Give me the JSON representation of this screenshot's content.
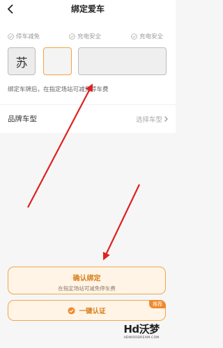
{
  "header": {
    "title": "绑定爱车",
    "back_icon": "chevron-left-icon"
  },
  "benefits": [
    {
      "label": "停车减免",
      "icon": "check-circle-icon"
    },
    {
      "label": "充电安全",
      "icon": "check-circle-icon"
    },
    {
      "label": "充电安全",
      "icon": "check-circle-icon"
    }
  ],
  "plate": {
    "province": "苏",
    "letter": "",
    "number": ""
  },
  "hint": "绑定车牌后，在指定场站可减免停车费",
  "brand_row": {
    "label": "品牌车型",
    "value": "选择车型",
    "icon": "chevron-right-icon"
  },
  "confirm_button": {
    "label": "确认绑定",
    "sublabel": "在指定场站可减免停车费"
  },
  "auth_button": {
    "label": "一键认证",
    "badge": "推荐",
    "icon": "check-circle-icon"
  },
  "watermark": {
    "main": "Hd沃梦",
    "sub": "HDWOODREAM.COM"
  },
  "colors": {
    "accent": "#f2a64a",
    "accent_text": "#d87e1a",
    "annotation_arrow": "#e02020"
  }
}
